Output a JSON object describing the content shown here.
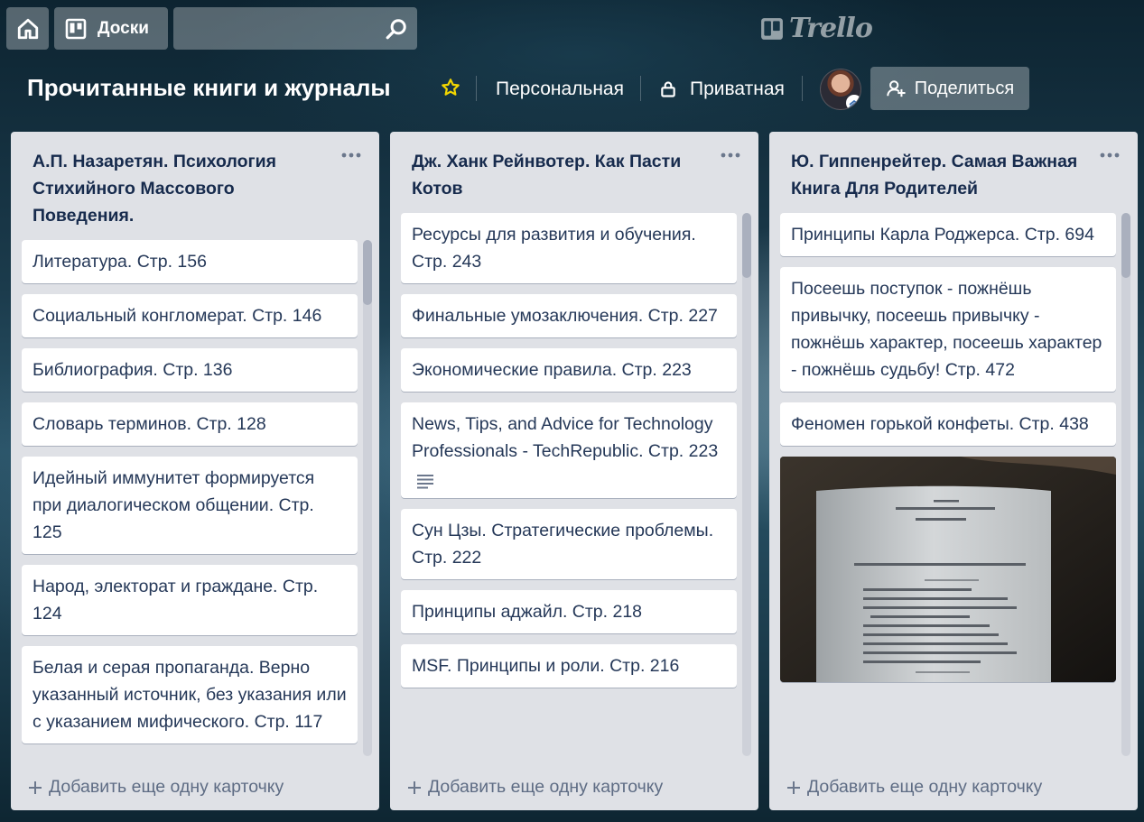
{
  "nav": {
    "home_icon": "home-icon",
    "boards_label": "Доски",
    "boards_icon": "board-icon",
    "search_placeholder": "",
    "search_icon": "search-icon",
    "logo_text": "Trello"
  },
  "board": {
    "title": "Прочитанные книги и журналы",
    "starred": true,
    "team": "Персональная",
    "visibility": "Приватная",
    "share_label": "Поделиться",
    "star_color": "#f2d600"
  },
  "add_card_label": "Добавить еще одну карточку",
  "lists": [
    {
      "title": "А.П. Назаретян. Психология Стихийного Массового Поведения.",
      "cards": [
        "Литература. Стр. 156",
        "Социальный конгломерат. Стр. 146",
        "Библиография. Стр. 136",
        "Словарь терминов. Стр. 128",
        "Идейный иммунитет формируется при диалогическом общении. Стр. 125",
        "Народ, электорат и граждане. Стр. 124",
        "Белая и серая пропаганда. Верно указанный источник, без указания или с указанием мифического. Стр. 117"
      ]
    },
    {
      "title": "Дж. Ханк Рейнвотер. Как Пасти Котов",
      "cards": [
        "Ресурсы для развития и обучения. Стр. 243",
        "Финальные умозаключения. Стр. 227",
        "Экономические правила. Стр. 223",
        "News, Tips, and Advice for Technology Professionals - TechRepublic. Стр. 223",
        "Сун Цзы. Стратегические проблемы. Стр. 222",
        "Принципы аджайл. Стр. 218",
        "MSF. Принципы и роли. Стр. 216"
      ]
    },
    {
      "title": "Ю. Гиппенрейтер. Самая Важная Книга Для Родителей",
      "cards": [
        "Принципы Карла Роджерса. Стр. 694",
        "Посеешь поступок - пожнёшь привычку, посеешь привычку - пожнёшь характер, посеешь характер - пожнёшь судьбу! Стр. 472",
        "Феномен горькой конфеты. Стр. 438"
      ]
    }
  ]
}
